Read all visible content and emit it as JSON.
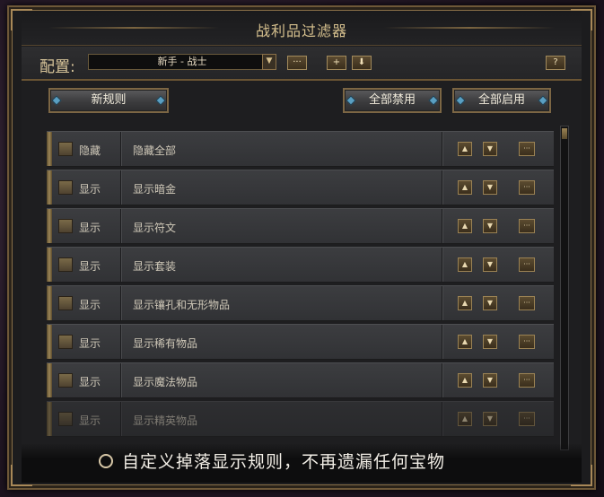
{
  "window": {
    "title": "战利品过滤器"
  },
  "config": {
    "label": "配置:",
    "profile": "新手 - 战士",
    "buttons": [
      "rename",
      "add",
      "download",
      "help"
    ],
    "button_glyphs": {
      "rename": "···",
      "add": "+",
      "download": "⬇",
      "help": "?"
    }
  },
  "actions": {
    "new_rule": "新规则",
    "disable_all": "全部禁用",
    "enable_all": "全部启用"
  },
  "rules": [
    {
      "mode": "隐藏",
      "name": "隐藏全部",
      "checked": false
    },
    {
      "mode": "显示",
      "name": "显示暗金",
      "checked": false
    },
    {
      "mode": "显示",
      "name": "显示符文",
      "checked": false
    },
    {
      "mode": "显示",
      "name": "显示套装",
      "checked": false
    },
    {
      "mode": "显示",
      "name": "显示镶孔和无形物品",
      "checked": false
    },
    {
      "mode": "显示",
      "name": "显示稀有物品",
      "checked": false
    },
    {
      "mode": "显示",
      "name": "显示魔法物品",
      "checked": false
    },
    {
      "mode": "显示",
      "name": "显示精英物品",
      "checked": false
    }
  ],
  "icons": {
    "move_up": "chevron-up-icon",
    "move_down": "chevron-down-icon",
    "edit": "ellipsis-icon"
  },
  "caption": "自定义掉落显示规则，不再遗漏任何宝物"
}
